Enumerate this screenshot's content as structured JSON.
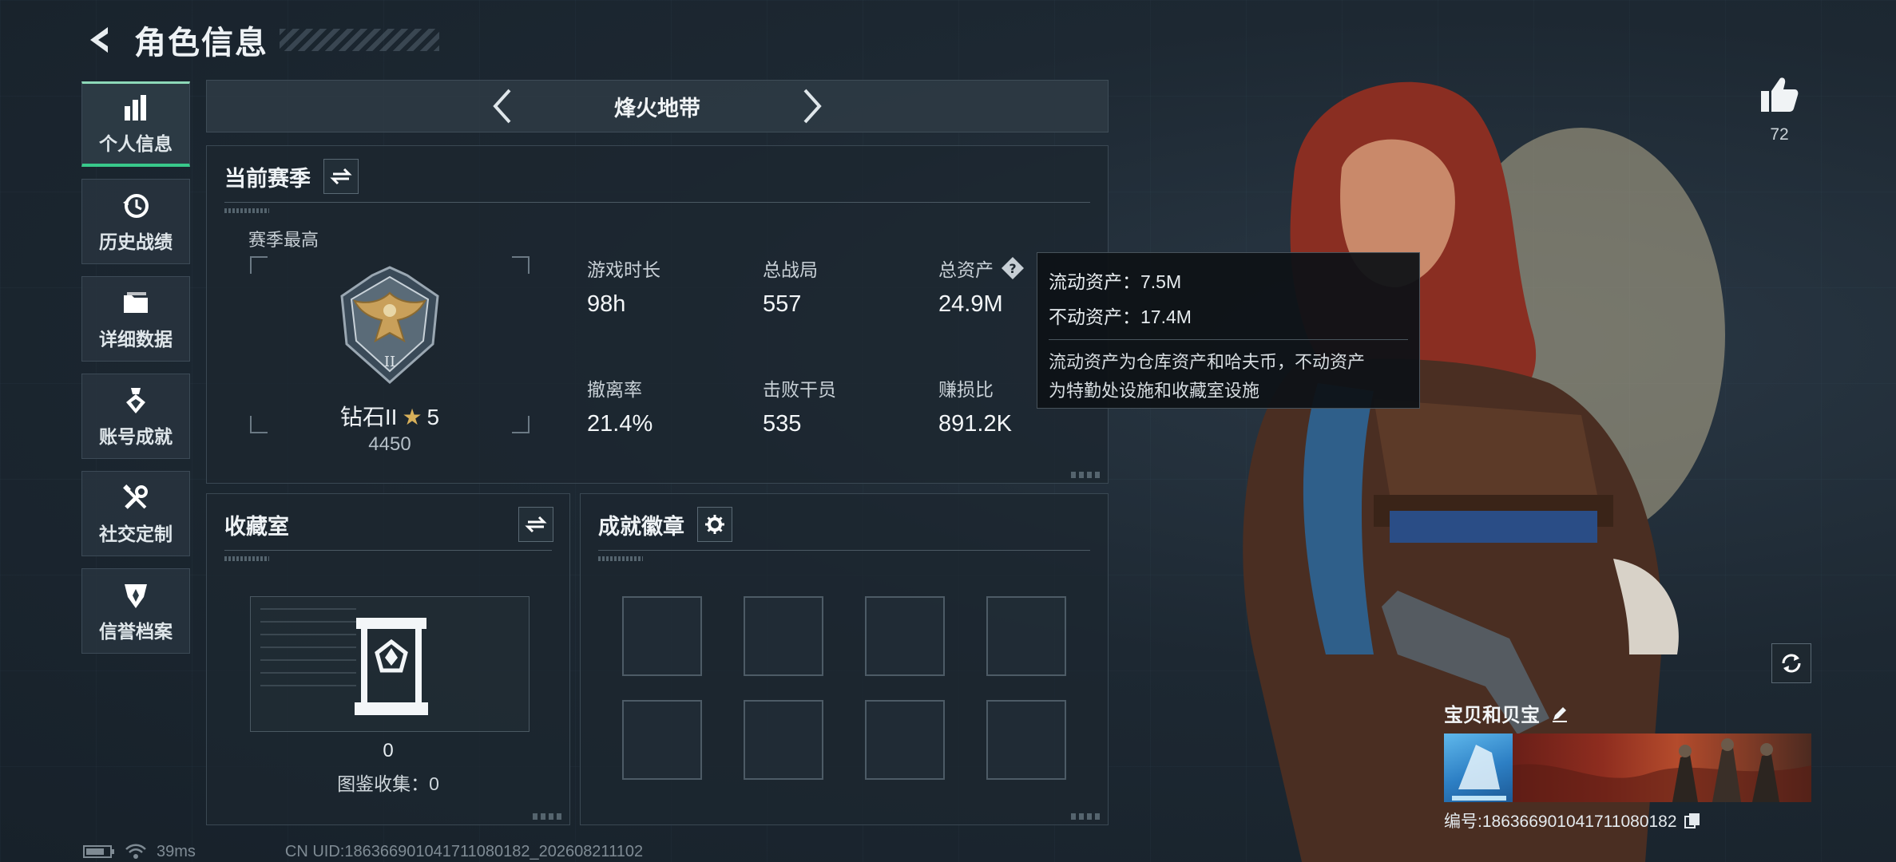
{
  "header": {
    "title": "角色信息",
    "back_icon": "back-arrow-icon"
  },
  "sidebar": {
    "items": [
      {
        "label": "个人信息",
        "icon": "bar-chart-icon",
        "active": true
      },
      {
        "label": "历史战绩",
        "icon": "history-clock-icon",
        "active": false
      },
      {
        "label": "详细数据",
        "icon": "folder-icon",
        "active": false
      },
      {
        "label": "账号成就",
        "icon": "achievement-medal-icon",
        "active": false
      },
      {
        "label": "社交定制",
        "icon": "wrench-tools-icon",
        "active": false
      },
      {
        "label": "信誉档案",
        "icon": "shield-badge-icon",
        "active": false
      }
    ]
  },
  "mode": {
    "title": "烽火地带"
  },
  "season": {
    "title": "当前赛季",
    "best_label": "赛季最高",
    "rank_name": "钻石II",
    "rank_star": "★",
    "rank_level": "5",
    "rank_points": "4450",
    "stats": [
      {
        "label": "游戏时长",
        "value": "98h"
      },
      {
        "label": "总战局",
        "value": "557"
      },
      {
        "label": "总资产",
        "value": "24.9M"
      },
      {
        "label": "撤离率",
        "value": "21.4%"
      },
      {
        "label": "击败干员",
        "value": "535"
      },
      {
        "label": "赚损比",
        "value": "891.2K"
      }
    ]
  },
  "tooltip": {
    "liquid": "流动资产：7.5M",
    "fixed": "不动资产：17.4M",
    "note_line1": "流动资产为仓库资产和哈夫币，不动资产",
    "note_line2": "为特勤处设施和收藏室设施"
  },
  "collection": {
    "title": "收藏室",
    "count": "0",
    "catalog": "图鉴收集：0"
  },
  "achievements": {
    "title": "成就徽章",
    "slots": 8
  },
  "like": {
    "count": "72"
  },
  "profile": {
    "name": "宝贝和贝宝",
    "uid_text": "编号:1863669010417110801​82"
  },
  "footer": {
    "ping": "39ms",
    "uid": "CN UID:1863669010417110801​82_202608211102"
  },
  "colors": {
    "accent_green": "#38c98b",
    "rank_gold": "#d8b05a",
    "background": "#1c2731"
  }
}
